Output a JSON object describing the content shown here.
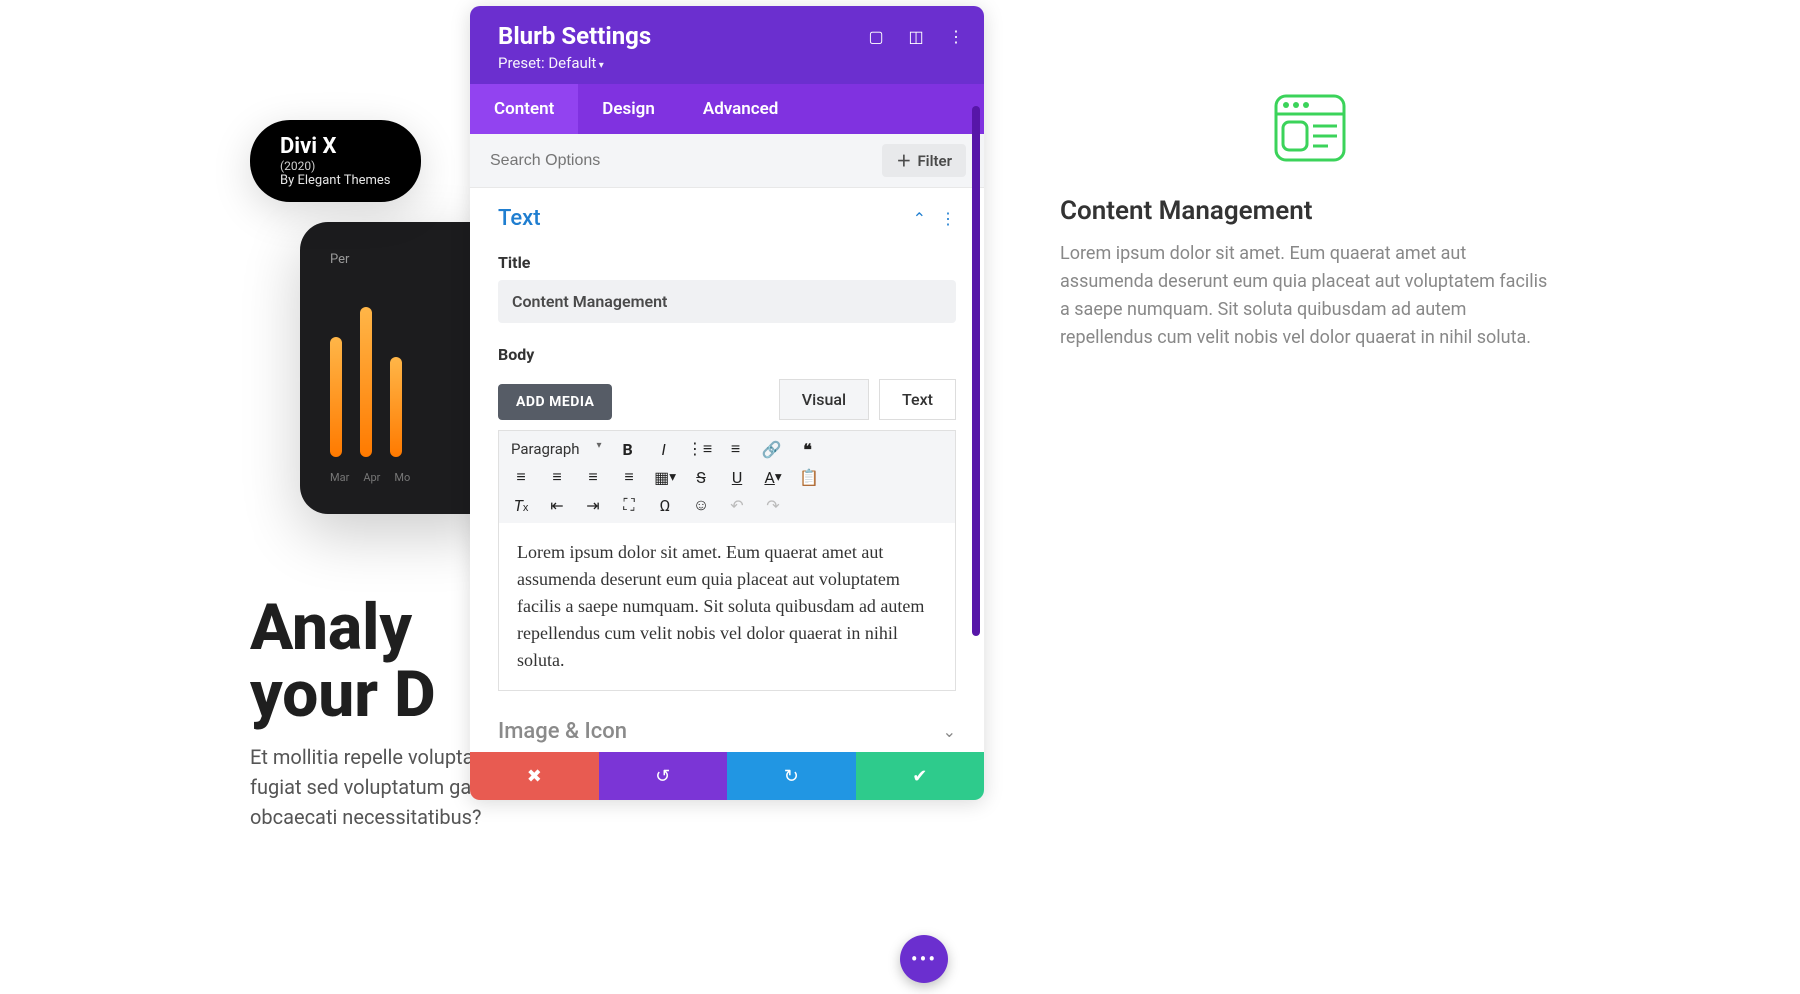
{
  "modal": {
    "title": "Blurb Settings",
    "preset": "Preset: Default",
    "tabs": {
      "content": "Content",
      "design": "Design",
      "advanced": "Advanced"
    },
    "search_placeholder": "Search Options",
    "filter": "Filter",
    "section_text": {
      "heading": "Text",
      "title_label": "Title",
      "title_value": "Content Management",
      "body_label": "Body",
      "add_media": "ADD MEDIA",
      "editor_tabs": {
        "visual": "Visual",
        "text": "Text"
      },
      "format_selector": "Paragraph",
      "body_content": "Lorem ipsum dolor sit amet. Eum quaerat amet aut assumenda deserunt eum quia placeat aut voluptatem facilis a saepe numquam. Sit soluta quibusdam ad autem repellendus cum velit nobis vel dolor quaerat in nihil soluta."
    },
    "section_image": "Image & Icon"
  },
  "bg_page": {
    "device": {
      "name": "Divi X",
      "year": "(2020)",
      "by": "By Elegant Themes"
    },
    "chart_label": "Per",
    "months": [
      "Mar",
      "Apr",
      "Mo"
    ],
    "heading": "Analy\nyour D",
    "text": "Et mollitia repelle voluptate. Eum il blanditiis aut cupiditate fugiat sed voluptatum galisum aut repellendus ratione rem obcaecati necessitatibus?"
  },
  "blurb": {
    "title": "Content Management",
    "body": "Lorem ipsum dolor sit amet. Eum quaerat amet aut assumenda deserunt eum quia placeat aut voluptatem facilis a saepe numquam. Sit soluta quibusdam ad autem repellendus cum velit nobis vel dolor quaerat in nihil soluta."
  },
  "colors": {
    "modal_header": "#6b2fcf",
    "tab_bg": "#8032e0"
  }
}
